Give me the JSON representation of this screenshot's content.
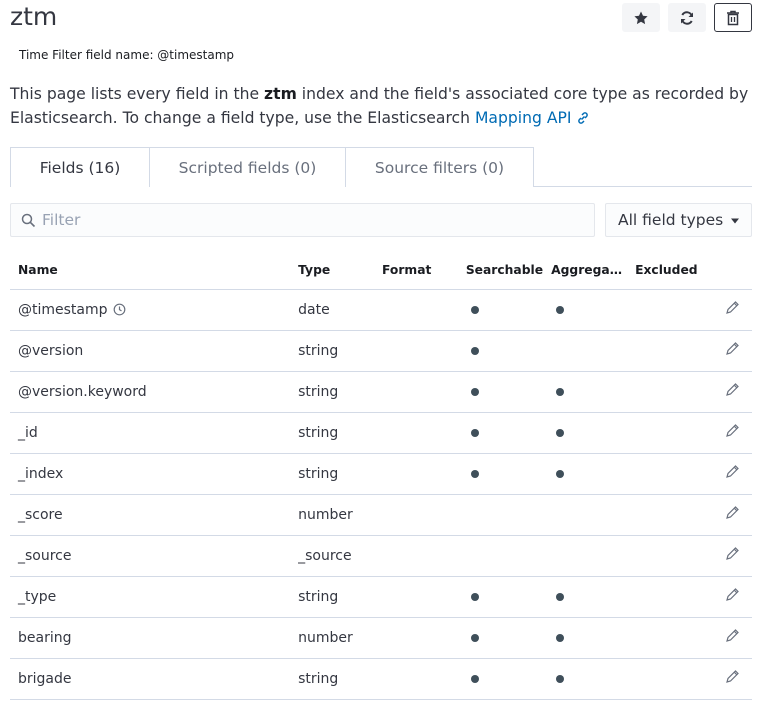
{
  "page": {
    "title": "ztm",
    "time_filter_label": "Time Filter field name: @timestamp",
    "description": {
      "part1": "This page lists every field in the ",
      "index_name": "ztm",
      "part2": " index and the field's associated core type as recorded by Elasticsearch. To change a field type, use the Elasticsearch ",
      "link_text": "Mapping API"
    }
  },
  "actions": {
    "favorite_icon": "star-icon",
    "refresh_icon": "refresh-icon",
    "delete_icon": "trash-icon"
  },
  "tabs": [
    {
      "label": "Fields (16)",
      "active": true
    },
    {
      "label": "Scripted fields (0)",
      "active": false
    },
    {
      "label": "Source filters (0)",
      "active": false
    }
  ],
  "filter": {
    "placeholder": "Filter",
    "value": ""
  },
  "type_select": {
    "selected": "All field types"
  },
  "table": {
    "headers": {
      "name": "Name",
      "type": "Type",
      "format": "Format",
      "searchable": "Searchable",
      "aggregatable": "Aggregat...",
      "excluded": "Excluded"
    },
    "rows": [
      {
        "name": "@timestamp",
        "type": "date",
        "format": "",
        "searchable": true,
        "aggregatable": true,
        "excluded": false,
        "time_icon": true
      },
      {
        "name": "@version",
        "type": "string",
        "format": "",
        "searchable": true,
        "aggregatable": false,
        "excluded": false
      },
      {
        "name": "@version.keyword",
        "type": "string",
        "format": "",
        "searchable": true,
        "aggregatable": true,
        "excluded": false
      },
      {
        "name": "_id",
        "type": "string",
        "format": "",
        "searchable": true,
        "aggregatable": true,
        "excluded": false
      },
      {
        "name": "_index",
        "type": "string",
        "format": "",
        "searchable": true,
        "aggregatable": true,
        "excluded": false
      },
      {
        "name": "_score",
        "type": "number",
        "format": "",
        "searchable": false,
        "aggregatable": false,
        "excluded": false
      },
      {
        "name": "_source",
        "type": "_source",
        "format": "",
        "searchable": false,
        "aggregatable": false,
        "excluded": false
      },
      {
        "name": "_type",
        "type": "string",
        "format": "",
        "searchable": true,
        "aggregatable": true,
        "excluded": false
      },
      {
        "name": "bearing",
        "type": "number",
        "format": "",
        "searchable": true,
        "aggregatable": true,
        "excluded": false
      },
      {
        "name": "brigade",
        "type": "string",
        "format": "",
        "searchable": true,
        "aggregatable": true,
        "excluded": false
      }
    ]
  },
  "colors": {
    "link": "#006bb4",
    "border": "#d3dae6",
    "text": "#343741",
    "dot": "#3f4f5a"
  }
}
